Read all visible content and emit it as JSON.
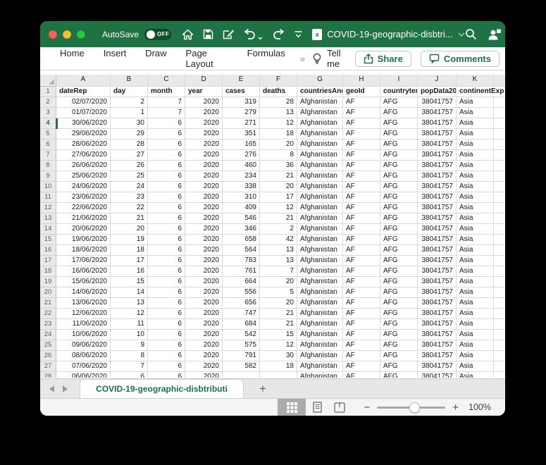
{
  "titlebar": {
    "autosave_label": "AutoSave",
    "autosave_state": "OFF",
    "document_title": "COVID-19-geographic-disbtri..."
  },
  "ribbon": {
    "tabs": [
      "Home",
      "Insert",
      "Draw",
      "Page Layout",
      "Formulas"
    ],
    "overflow_indicator": "»",
    "tell_me_label": "Tell me",
    "share_label": "Share",
    "comments_label": "Comments"
  },
  "spreadsheet": {
    "column_letters": [
      "A",
      "B",
      "C",
      "D",
      "E",
      "F",
      "G",
      "H",
      "I",
      "J",
      "K"
    ],
    "header_row_number": "1",
    "header_cells": [
      "dateRep",
      "day",
      "month",
      "year",
      "cases",
      "deaths",
      "countriesAndT",
      "geoId",
      "countryter",
      "popData20",
      "continentExp"
    ],
    "selected_row": "4",
    "rows": [
      [
        "2",
        "02/07/2020",
        "2",
        "7",
        "2020",
        "319",
        "28",
        "Afghanistan",
        "AF",
        "AFG",
        "38041757",
        "Asia"
      ],
      [
        "3",
        "01/07/2020",
        "1",
        "7",
        "2020",
        "279",
        "13",
        "Afghanistan",
        "AF",
        "AFG",
        "38041757",
        "Asia"
      ],
      [
        "4",
        "30/06/2020",
        "30",
        "6",
        "2020",
        "271",
        "12",
        "Afghanistan",
        "AF",
        "AFG",
        "38041757",
        "Asia"
      ],
      [
        "5",
        "29/06/2020",
        "29",
        "6",
        "2020",
        "351",
        "18",
        "Afghanistan",
        "AF",
        "AFG",
        "38041757",
        "Asia"
      ],
      [
        "6",
        "28/06/2020",
        "28",
        "6",
        "2020",
        "165",
        "20",
        "Afghanistan",
        "AF",
        "AFG",
        "38041757",
        "Asia"
      ],
      [
        "7",
        "27/06/2020",
        "27",
        "6",
        "2020",
        "276",
        "8",
        "Afghanistan",
        "AF",
        "AFG",
        "38041757",
        "Asia"
      ],
      [
        "8",
        "26/06/2020",
        "26",
        "6",
        "2020",
        "460",
        "36",
        "Afghanistan",
        "AF",
        "AFG",
        "38041757",
        "Asia"
      ],
      [
        "9",
        "25/06/2020",
        "25",
        "6",
        "2020",
        "234",
        "21",
        "Afghanistan",
        "AF",
        "AFG",
        "38041757",
        "Asia"
      ],
      [
        "10",
        "24/06/2020",
        "24",
        "6",
        "2020",
        "338",
        "20",
        "Afghanistan",
        "AF",
        "AFG",
        "38041757",
        "Asia"
      ],
      [
        "11",
        "23/06/2020",
        "23",
        "6",
        "2020",
        "310",
        "17",
        "Afghanistan",
        "AF",
        "AFG",
        "38041757",
        "Asia"
      ],
      [
        "12",
        "22/06/2020",
        "22",
        "6",
        "2020",
        "409",
        "12",
        "Afghanistan",
        "AF",
        "AFG",
        "38041757",
        "Asia"
      ],
      [
        "13",
        "21/06/2020",
        "21",
        "6",
        "2020",
        "546",
        "21",
        "Afghanistan",
        "AF",
        "AFG",
        "38041757",
        "Asia"
      ],
      [
        "14",
        "20/06/2020",
        "20",
        "6",
        "2020",
        "346",
        "2",
        "Afghanistan",
        "AF",
        "AFG",
        "38041757",
        "Asia"
      ],
      [
        "15",
        "19/06/2020",
        "19",
        "6",
        "2020",
        "658",
        "42",
        "Afghanistan",
        "AF",
        "AFG",
        "38041757",
        "Asia"
      ],
      [
        "16",
        "18/06/2020",
        "18",
        "6",
        "2020",
        "564",
        "13",
        "Afghanistan",
        "AF",
        "AFG",
        "38041757",
        "Asia"
      ],
      [
        "17",
        "17/06/2020",
        "17",
        "6",
        "2020",
        "783",
        "13",
        "Afghanistan",
        "AF",
        "AFG",
        "38041757",
        "Asia"
      ],
      [
        "18",
        "16/06/2020",
        "16",
        "6",
        "2020",
        "761",
        "7",
        "Afghanistan",
        "AF",
        "AFG",
        "38041757",
        "Asia"
      ],
      [
        "19",
        "15/06/2020",
        "15",
        "6",
        "2020",
        "664",
        "20",
        "Afghanistan",
        "AF",
        "AFG",
        "38041757",
        "Asia"
      ],
      [
        "20",
        "14/06/2020",
        "14",
        "6",
        "2020",
        "556",
        "5",
        "Afghanistan",
        "AF",
        "AFG",
        "38041757",
        "Asia"
      ],
      [
        "21",
        "13/06/2020",
        "13",
        "6",
        "2020",
        "656",
        "20",
        "Afghanistan",
        "AF",
        "AFG",
        "38041757",
        "Asia"
      ],
      [
        "22",
        "12/06/2020",
        "12",
        "6",
        "2020",
        "747",
        "21",
        "Afghanistan",
        "AF",
        "AFG",
        "38041757",
        "Asia"
      ],
      [
        "23",
        "11/06/2020",
        "11",
        "6",
        "2020",
        "684",
        "21",
        "Afghanistan",
        "AF",
        "AFG",
        "38041757",
        "Asia"
      ],
      [
        "24",
        "10/06/2020",
        "10",
        "6",
        "2020",
        "542",
        "15",
        "Afghanistan",
        "AF",
        "AFG",
        "38041757",
        "Asia"
      ],
      [
        "25",
        "09/06/2020",
        "9",
        "6",
        "2020",
        "575",
        "12",
        "Afghanistan",
        "AF",
        "AFG",
        "38041757",
        "Asia"
      ],
      [
        "26",
        "08/06/2020",
        "8",
        "6",
        "2020",
        "791",
        "30",
        "Afghanistan",
        "AF",
        "AFG",
        "38041757",
        "Asia"
      ],
      [
        "27",
        "07/06/2020",
        "7",
        "6",
        "2020",
        "582",
        "18",
        "Afghanistan",
        "AF",
        "AFG",
        "38041757",
        "Asia"
      ]
    ],
    "partial_row": [
      "28",
      "06/06/2020",
      "6",
      "6",
      "2020",
      "",
      "",
      "Afghanistan",
      "AF",
      "AFG",
      "38041757",
      "Asia"
    ]
  },
  "sheet_tabs": {
    "active_tab_label": "COVID-19-geographic-disbtributi",
    "add_tab_label": "+"
  },
  "status_bar": {
    "zoom_label": "100%"
  },
  "colors": {
    "titlebar_green": "#1f7244",
    "excel_accent_green": "#1e7145",
    "traffic_red": "#ff5f57",
    "traffic_yellow": "#febc2e",
    "traffic_green": "#28c840"
  }
}
